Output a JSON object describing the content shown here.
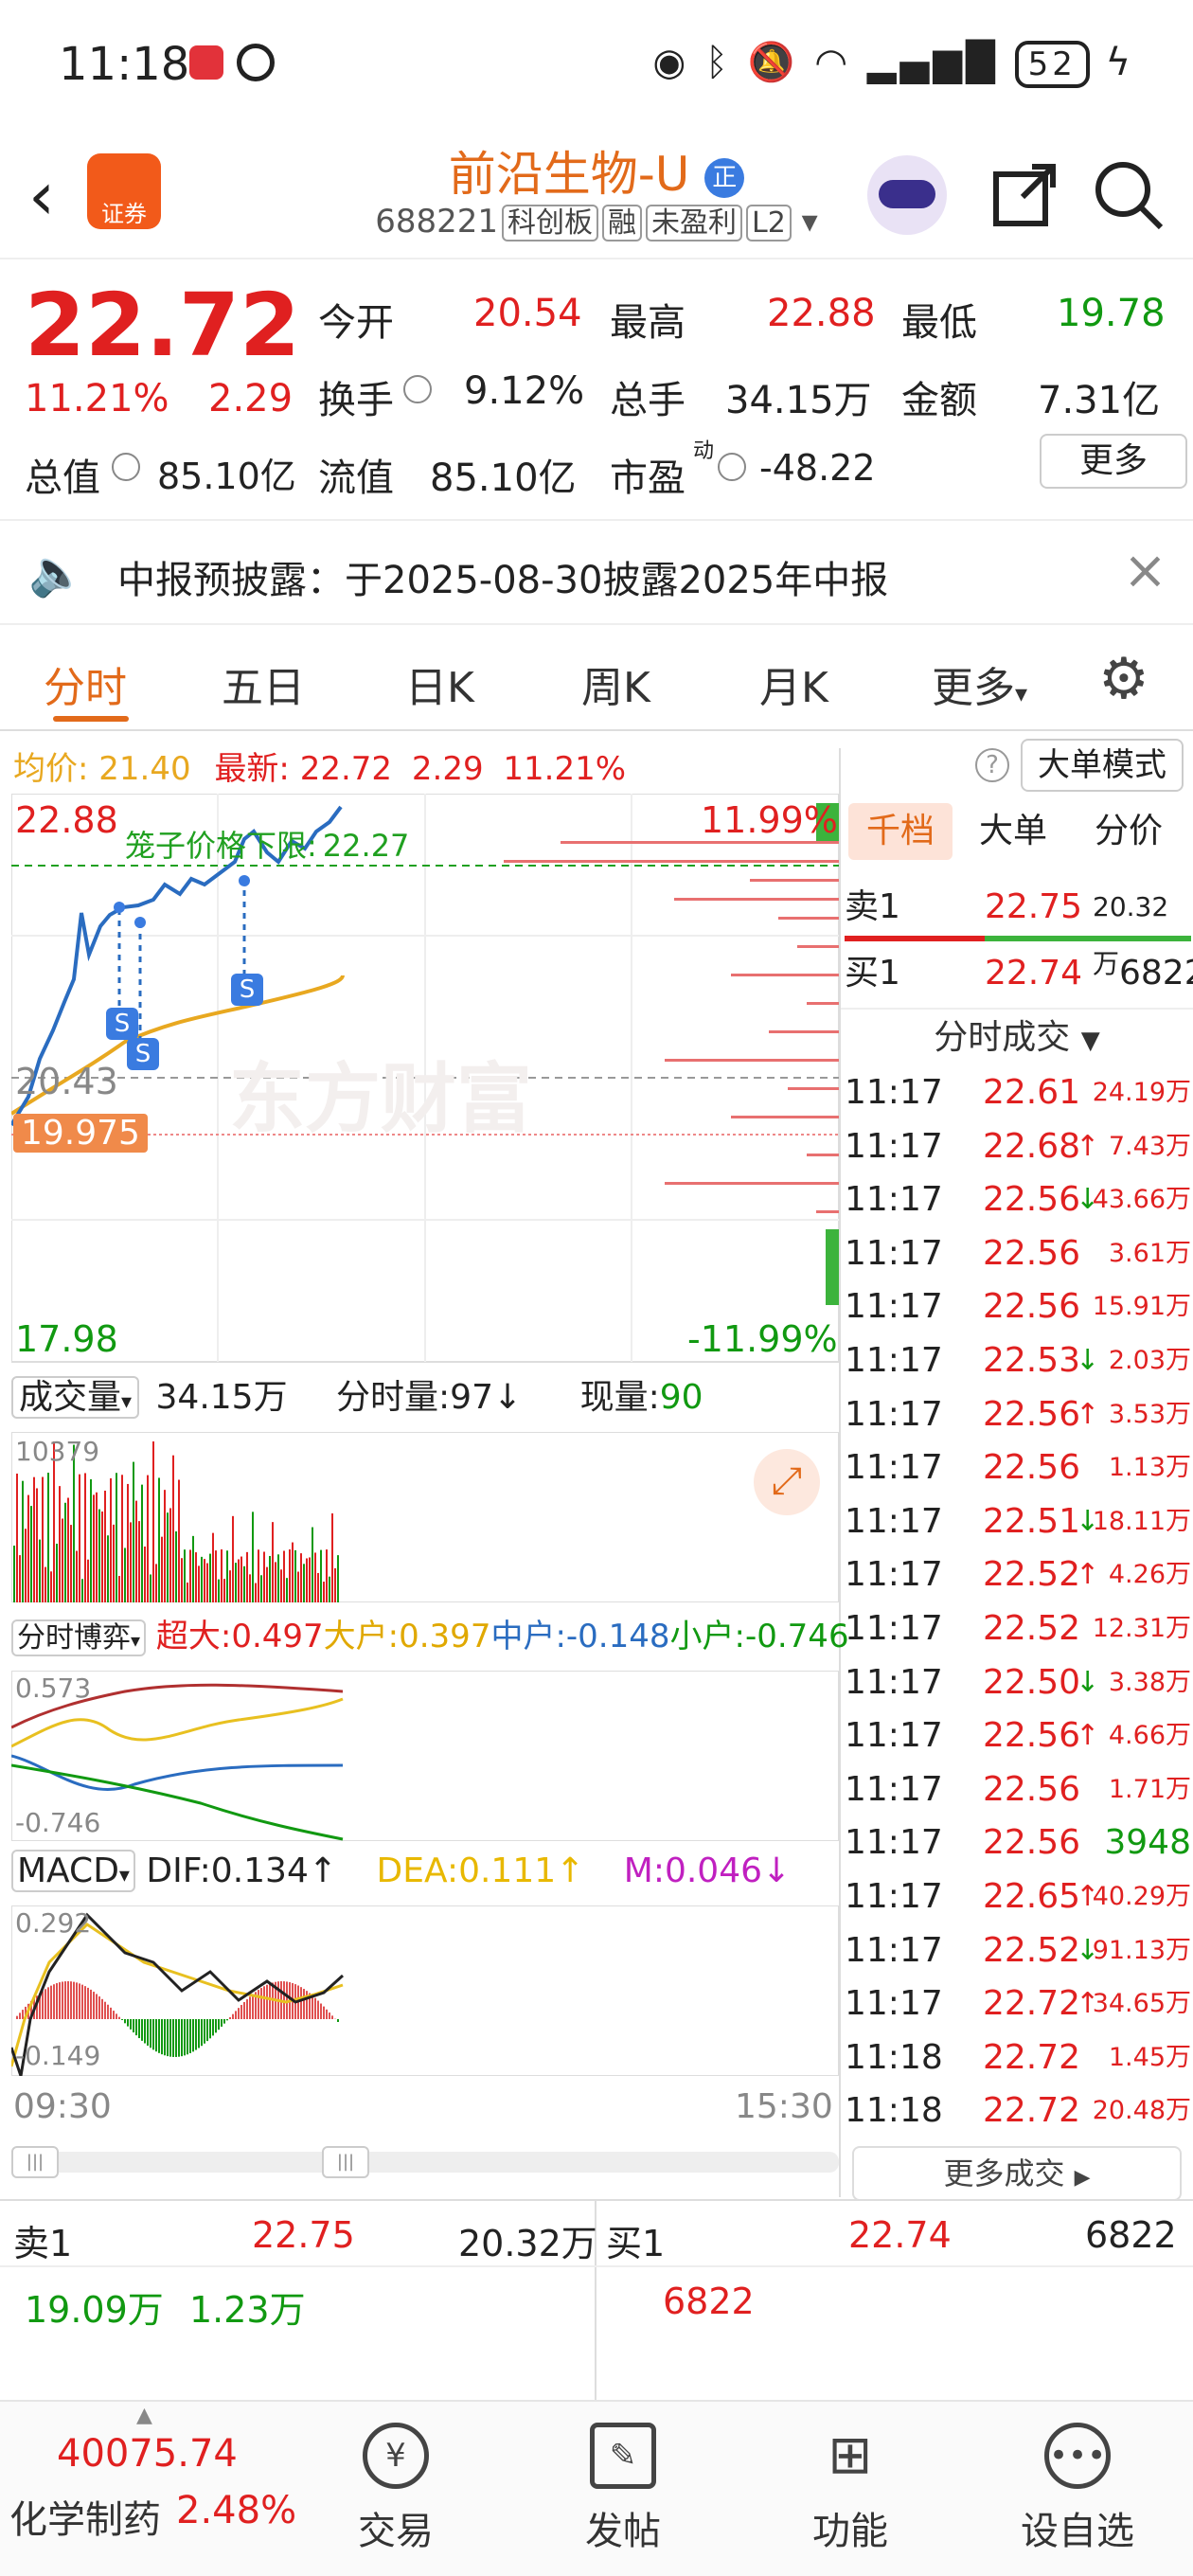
{
  "status_bar": {
    "time": "11:18",
    "battery": "52"
  },
  "header": {
    "stock_name": "前沿生物-U",
    "stock_badge": "正",
    "stock_code": "688221",
    "tags": [
      "科创板",
      "融",
      "未盈利",
      "L2"
    ],
    "logo_text": "证券"
  },
  "quote": {
    "price": "22.72",
    "change_pct": "11.21%",
    "change_amt": "2.29",
    "open_label": "今开",
    "open": "20.54",
    "high_label": "最高",
    "high": "22.88",
    "low_label": "最低",
    "low": "19.78",
    "turnover_label": "换手",
    "turnover": "9.12%",
    "volume_label": "总手",
    "volume": "34.15万",
    "amount_label": "金额",
    "amount": "7.31亿",
    "mktcap_label": "总值",
    "mktcap": "85.10亿",
    "float_label": "流值",
    "float_cap": "85.10亿",
    "pe_label": "市盈",
    "pe_sup": "动",
    "pe": "-48.22",
    "more": "更多"
  },
  "notice": {
    "text": "中报预披露：于2025-08-30披露2025年中报"
  },
  "tabs": [
    "分时",
    "五日",
    "日K",
    "周K",
    "月K",
    "更多"
  ],
  "chart": {
    "summary": {
      "avg_label": "均价:",
      "avg": "21.40",
      "last_label": "最新:",
      "last": "22.72",
      "chg": "2.29",
      "pct": "11.21%"
    },
    "big_order_btn": "大单模式",
    "y_top": "22.88",
    "y_top_pct": "11.99%",
    "y_bottom": "17.98",
    "y_bottom_pct": "-11.99%",
    "prev_close": "20.43",
    "cage_label": "笼子价格下限:",
    "cage_value": "22.27",
    "marker_price": "19.975",
    "watermark": "东方财富",
    "sell_marker": "S",
    "volume_bar": {
      "label": "成交量",
      "total": "34.15万",
      "min_label": "分时量:",
      "min_val": "97↓",
      "cur_label": "现量:",
      "cur_val": "90",
      "axis_top": "10379"
    },
    "game_bar": {
      "label": "分时博弈",
      "items": [
        {
          "text": "超大:0.497",
          "color": "#e02020"
        },
        {
          "text": "大户:0.397",
          "color": "#e0a800"
        },
        {
          "text": "中户:-0.148",
          "color": "#2a6cc0"
        },
        {
          "text": "小户:-0.746",
          "color": "#119911"
        }
      ],
      "axis_top": "0.573",
      "axis_bottom": "-0.746"
    },
    "macd_bar": {
      "label": "MACD",
      "dif": "DIF:0.134↑",
      "dea": "DEA:0.111↑",
      "m": "M:0.046↓",
      "axis_top": "0.292",
      "axis_bottom": "-0.149"
    },
    "time_start": "09:30",
    "time_end": "15:30"
  },
  "right_panel": {
    "tabs": [
      "千档",
      "大单",
      "分价"
    ],
    "sell1": {
      "label": "卖1",
      "price": "22.75",
      "vol": "20.32万"
    },
    "buy1": {
      "label": "买1",
      "price": "22.74",
      "vol": "6822"
    },
    "ticks_title": "分时成交",
    "ticks": [
      {
        "t": "11:17",
        "p": "22.61",
        "d": "",
        "v": "24.19万"
      },
      {
        "t": "11:17",
        "p": "22.68",
        "d": "↑",
        "v": "7.43万"
      },
      {
        "t": "11:17",
        "p": "22.56",
        "d": "↓",
        "v": "43.66万"
      },
      {
        "t": "11:17",
        "p": "22.56",
        "d": "",
        "v": "3.61万"
      },
      {
        "t": "11:17",
        "p": "22.56",
        "d": "",
        "v": "15.91万"
      },
      {
        "t": "11:17",
        "p": "22.53",
        "d": "↓",
        "v": "2.03万"
      },
      {
        "t": "11:17",
        "p": "22.56",
        "d": "↑",
        "v": "3.53万"
      },
      {
        "t": "11:17",
        "p": "22.56",
        "d": "",
        "v": "1.13万"
      },
      {
        "t": "11:17",
        "p": "22.51",
        "d": "↓",
        "v": "18.11万"
      },
      {
        "t": "11:17",
        "p": "22.52",
        "d": "↑",
        "v": "4.26万"
      },
      {
        "t": "11:17",
        "p": "22.52",
        "d": "",
        "v": "12.31万"
      },
      {
        "t": "11:17",
        "p": "22.50",
        "d": "↓",
        "v": "3.38万"
      },
      {
        "t": "11:17",
        "p": "22.56",
        "d": "↑",
        "v": "4.66万"
      },
      {
        "t": "11:17",
        "p": "22.56",
        "d": "",
        "v": "1.71万"
      },
      {
        "t": "11:17",
        "p": "22.56",
        "d": "",
        "v": "3948"
      },
      {
        "t": "11:17",
        "p": "22.65",
        "d": "↑",
        "v": "40.29万"
      },
      {
        "t": "11:17",
        "p": "22.52",
        "d": "↓",
        "v": "91.13万"
      },
      {
        "t": "11:17",
        "p": "22.72",
        "d": "↑",
        "v": "34.65万"
      },
      {
        "t": "11:18",
        "p": "22.72",
        "d": "",
        "v": "1.45万"
      },
      {
        "t": "11:18",
        "p": "22.72",
        "d": "",
        "v": "20.48万"
      }
    ],
    "more_ticks": "更多成交"
  },
  "orderbook": {
    "sell_label": "卖1",
    "sell_price": "22.75",
    "sell_vol": "20.32万",
    "sell_sub1": "19.09万",
    "sell_sub2": "1.23万",
    "buy_label": "买1",
    "buy_price": "22.74",
    "buy_vol": "6822",
    "buy_sub1": "6822"
  },
  "bottom_nav": {
    "index_value": "40075.74",
    "sector": "化学制药",
    "sector_pct": "2.48%",
    "items": [
      "交易",
      "发帖",
      "功能",
      "设自选"
    ]
  },
  "colors": {
    "up": "#e02020",
    "down": "#119911",
    "accent": "#e26a1a",
    "avg_line": "#e8a820",
    "price_line": "#2a6cc0"
  }
}
